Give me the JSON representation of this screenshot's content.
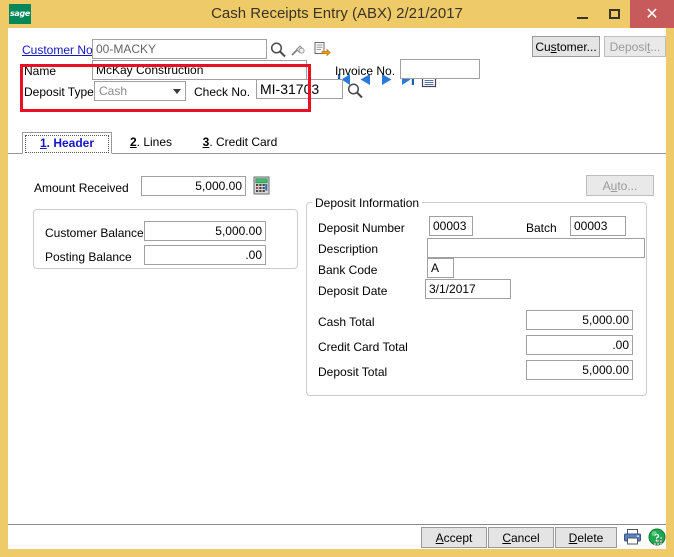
{
  "window": {
    "title": "Cash Receipts Entry (ABX) 2/21/2017",
    "logo_text": "sage",
    "minimize_label": "Minimize",
    "maximize_label": "Maximize",
    "close_label": "✕",
    "titlebar_color": "#EECB68",
    "close_color": "#C75A5A"
  },
  "header": {
    "customer_no_label": "Customer No.",
    "customer_no_value": "00-MACKY",
    "name_label": "Name",
    "name_value": "McKay Construction",
    "deposit_type_label": "Deposit Type",
    "deposit_type_value": "Cash",
    "check_no_label": "Check No.",
    "check_no_value": "MI-31703",
    "invoice_no_label": "Invoice No.",
    "invoice_no_value": "",
    "highlight_color": "#E81123",
    "link_color": "#1414C8",
    "icons": {
      "lookup": "magnifier-icon",
      "pin": "pin-icon",
      "memo": "memo-icon",
      "first": "first-record-icon",
      "prev": "previous-record-icon",
      "next": "next-record-icon",
      "last": "last-record-icon",
      "notes": "notepad-icon",
      "check_lookup": "magnifier-icon"
    },
    "buttons": {
      "customer": {
        "label": "Customer...",
        "accel": "s",
        "enabled": true
      },
      "deposit": {
        "label": "Deposit...",
        "accel": "t",
        "enabled": false
      }
    }
  },
  "tabs": [
    {
      "num": "1",
      "label": "Header",
      "active": true
    },
    {
      "num": "2",
      "label": "Lines",
      "active": false
    },
    {
      "num": "3",
      "label": "Credit Card",
      "active": false
    }
  ],
  "main": {
    "amount_received_label": "Amount Received",
    "amount_received_value": "5,000.00",
    "calculator_icon": "calculator-icon",
    "auto_button": {
      "label": "Auto...",
      "accel": "u",
      "enabled": false
    },
    "balances": {
      "customer_balance_label": "Customer Balance",
      "customer_balance_value": "5,000.00",
      "posting_balance_label": "Posting Balance",
      "posting_balance_value": ".00"
    },
    "deposit_info": {
      "group_label": "Deposit Information",
      "deposit_number_label": "Deposit Number",
      "deposit_number_value": "00003",
      "batch_label": "Batch",
      "batch_value": "00003",
      "description_label": "Description",
      "description_value": "",
      "bank_code_label": "Bank Code",
      "bank_code_value": "A",
      "deposit_date_label": "Deposit Date",
      "deposit_date_value": "3/1/2017"
    },
    "totals": {
      "cash_total_label": "Cash Total",
      "cash_total_value": "5,000.00",
      "credit_card_total_label": "Credit Card Total",
      "credit_card_total_value": ".00",
      "deposit_total_label": "Deposit Total",
      "deposit_total_value": "5,000.00"
    }
  },
  "footer": {
    "accept": {
      "label": "Accept",
      "accel": "A"
    },
    "cancel": {
      "label": "Cancel",
      "accel": "C"
    },
    "delete": {
      "label": "Delete",
      "accel": "D"
    },
    "print_icon": "printer-icon",
    "help_icon": "help-icon"
  }
}
